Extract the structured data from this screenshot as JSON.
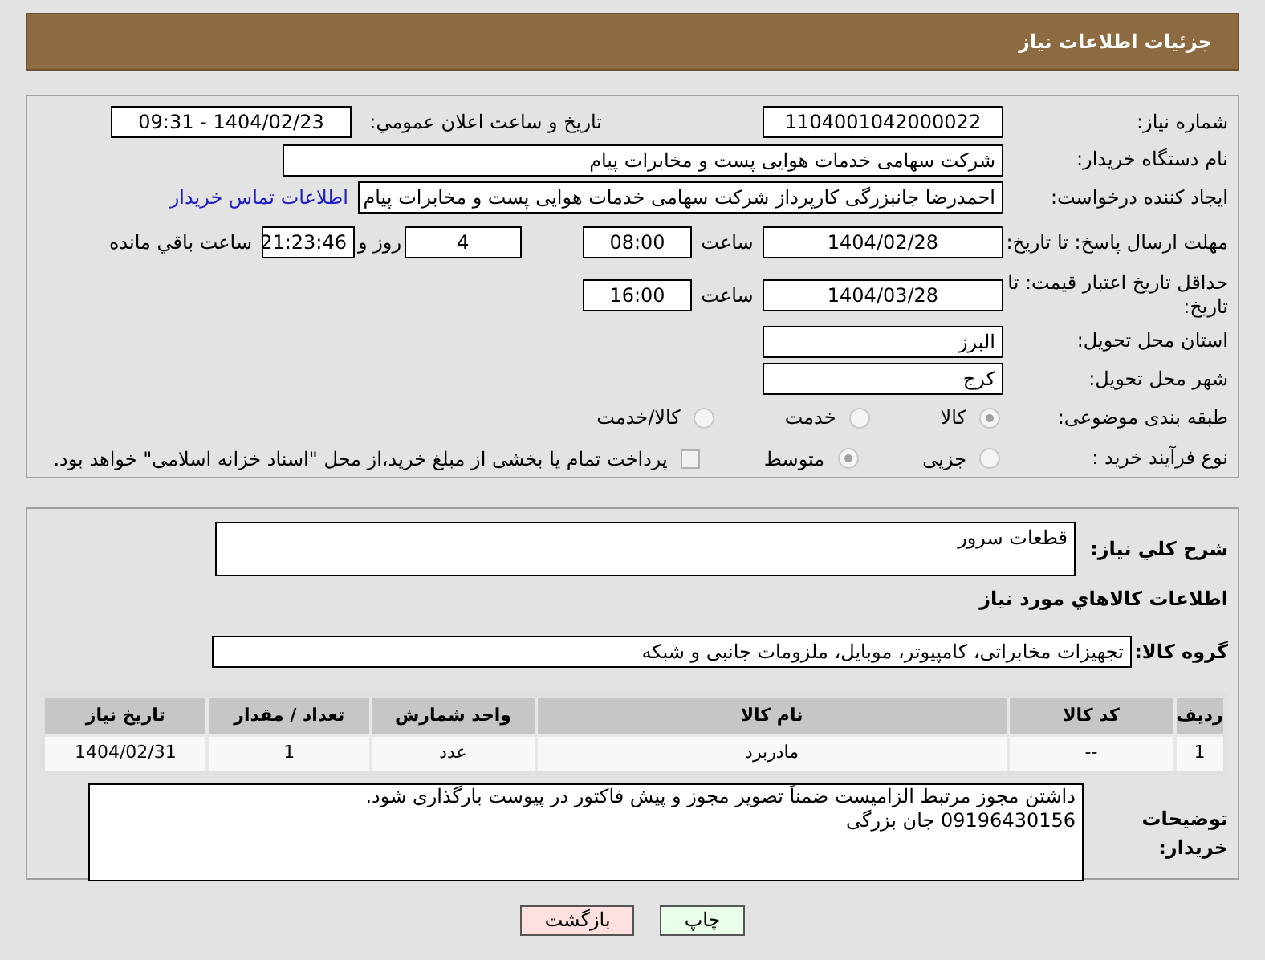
{
  "header": {
    "title": "جزئیات اطلاعات نیاز"
  },
  "need_number": {
    "label": "شماره نیاز:",
    "value": "1104001042000022"
  },
  "announce": {
    "label": "تاریخ و ساعت اعلان عمومي:",
    "value": "1404/02/23 - 09:31"
  },
  "buyer": {
    "label": "نام دستگاه خریدار:",
    "value": "شرکت سهامی خدمات هوایی پست و مخابرات پیام"
  },
  "creator": {
    "label": "ایجاد کننده درخواست:",
    "value": "احمدرضا جانبزرگی کارپرداز شرکت سهامی خدمات هوایی پست و مخابرات پیام",
    "link": "اطلاعات تماس خریدار"
  },
  "deadline": {
    "label": "مهلت ارسال پاسخ: تا تاریخ:",
    "date": "1404/02/28",
    "time_label": "ساعت",
    "time": "08:00",
    "days": "4",
    "days_label": "روز و",
    "remaining": "21:23:46",
    "remaining_label": "ساعت باقي مانده"
  },
  "validity": {
    "label": "حداقل تاریخ اعتبار قیمت: تا تاریخ:",
    "date": "1404/03/28",
    "time_label": "ساعت",
    "time": "16:00"
  },
  "province": {
    "label": "استان محل تحویل:",
    "value": "البرز"
  },
  "city": {
    "label": "شهر محل تحویل:",
    "value": "کرج"
  },
  "category": {
    "label": "طبقه بندی موضوعی:",
    "options": [
      {
        "label": "کالا",
        "selected": true
      },
      {
        "label": "خدمت",
        "selected": false
      },
      {
        "label": "کالا/خدمت",
        "selected": false
      }
    ]
  },
  "process": {
    "label": "نوع فرآیند خرید :",
    "options": [
      {
        "label": "جزیی",
        "selected": false
      },
      {
        "label": "متوسط",
        "selected": true
      }
    ],
    "payment": {
      "label": "پرداخت تمام یا بخشی از مبلغ خرید،از محل \"اسناد خزانه اسلامی\" خواهد بود.",
      "checked": false
    }
  },
  "description": {
    "label": "شرح کلي نياز:",
    "value": "قطعات سرور"
  },
  "goods_title": "اطلاعات کالاهاي مورد نياز",
  "group": {
    "label": "گروه کالا:",
    "value": "تجهیزات مخابراتی، کامپیوتر، موبایل، ملزومات جانبی و شبکه"
  },
  "table": {
    "columns": [
      "ردیف",
      "کد کالا",
      "نام کالا",
      "واحد شمارش",
      "تعداد / مقدار",
      "تاریخ نیاز"
    ],
    "rows": [
      [
        "1",
        "--",
        "مادربرد",
        "عدد",
        "1",
        "1404/02/31"
      ]
    ]
  },
  "notes": {
    "label": "توضیحات خریدار:",
    "lines": [
      "داشتن مجوز مرتبط الزامیست ضمناً تصویر مجوز و پیش فاکتور در پیوست بارگذاری شود.",
      "09196430156 جان بزرگی"
    ]
  },
  "buttons": [
    {
      "label": "چاپ",
      "kind": "print"
    },
    {
      "label": "بازگشت",
      "kind": "back"
    }
  ]
}
